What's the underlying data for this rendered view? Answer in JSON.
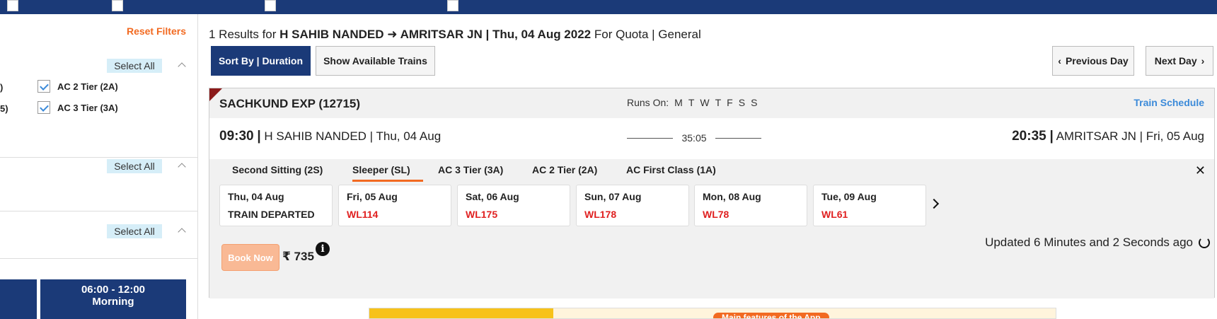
{
  "sidebar": {
    "reset_filters": "Reset Filters",
    "select_all_label": "Select All",
    "class_checks": [
      {
        "label": "AC 2 Tier (2A)",
        "checked": true
      },
      {
        "label": "AC 3 Tier (3A)",
        "checked": true
      }
    ],
    "left_partial": [
      ")",
      "5)"
    ],
    "time_slot": {
      "time": "06:00 - 12:00",
      "label": "Morning"
    }
  },
  "results": {
    "count_prefix": "1 Results for",
    "route": "H SAHIB NANDED ➜ AMRITSAR JN | Thu, 04 Aug 2022",
    "quota_text": "For Quota | General"
  },
  "toolbar": {
    "sort_label": "Sort By | Duration",
    "available_label": "Show Available Trains",
    "prev_day": "Previous Day",
    "next_day": "Next Day"
  },
  "train": {
    "name": "SACHKUND EXP (12715)",
    "runs_on_label": "Runs On:",
    "runs_on_days": [
      "M",
      "T",
      "W",
      "T",
      "F",
      "S",
      "S"
    ],
    "schedule_link": "Train Schedule",
    "departure": {
      "time": "09:30",
      "station_date": "H SAHIB NANDED | Thu, 04 Aug"
    },
    "duration": "35:05",
    "arrival": {
      "time": "20:35",
      "station_date": "AMRITSAR JN | Fri, 05 Aug"
    }
  },
  "classes": [
    {
      "label": "Second Sitting (2S)",
      "active": false
    },
    {
      "label": "Sleeper (SL)",
      "active": true
    },
    {
      "label": "AC 3 Tier (3A)",
      "active": false
    },
    {
      "label": "AC 2 Tier (2A)",
      "active": false
    },
    {
      "label": "AC First Class (1A)",
      "active": false
    }
  ],
  "availability": [
    {
      "date": "Thu, 04 Aug",
      "status": "TRAIN DEPARTED"
    },
    {
      "date": "Fri, 05 Aug",
      "status": "WL114"
    },
    {
      "date": "Sat, 06 Aug",
      "status": "WL175"
    },
    {
      "date": "Sun, 07 Aug",
      "status": "WL178"
    },
    {
      "date": "Mon, 08 Aug",
      "status": "WL78"
    },
    {
      "date": "Tue, 09 Aug",
      "status": "WL61"
    }
  ],
  "booking": {
    "book_now": "Book Now",
    "price": "₹ 735",
    "updated": "Updated 6 Minutes and 2 Seconds ago"
  },
  "banner": {
    "pill_text": "Main features of the App"
  },
  "colors": {
    "navy": "#1b3a78",
    "orange": "#f26a21",
    "waitlist_red": "#e02020",
    "link_blue": "#3b8ad9"
  }
}
